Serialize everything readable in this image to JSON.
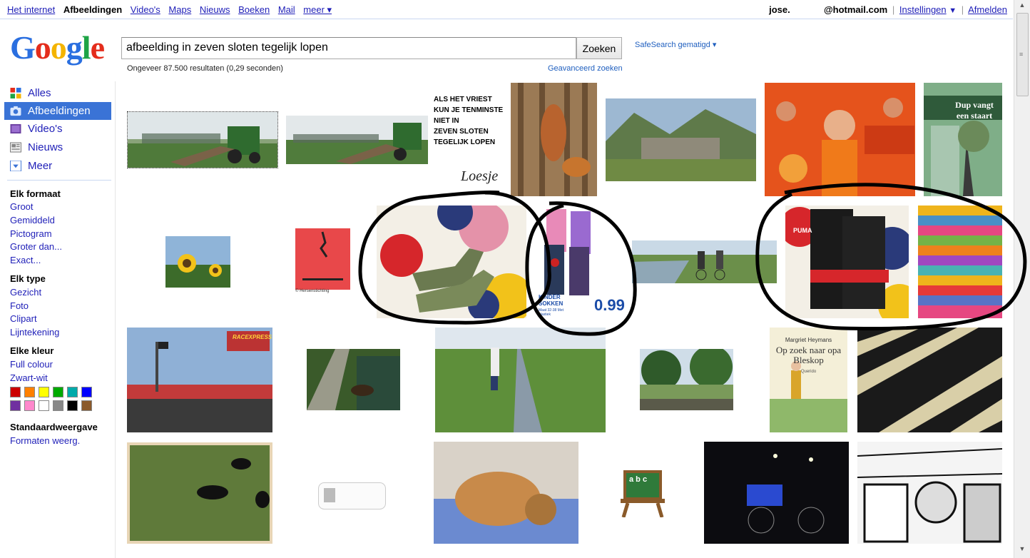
{
  "topnav": {
    "items": [
      "Het internet",
      "Afbeeldingen",
      "Video's",
      "Maps",
      "Nieuws",
      "Boeken",
      "Mail",
      "meer ▾"
    ],
    "active_index": 1
  },
  "account": {
    "user": "jose.",
    "email": "@hotmail.com",
    "settings": "Instellingen",
    "settings_arrow": "▼",
    "signout": "Afmelden"
  },
  "logo": {
    "letters": [
      "G",
      "o",
      "o",
      "g",
      "l",
      "e"
    ]
  },
  "search": {
    "query": "afbeelding in zeven sloten tegelijk lopen",
    "button": "Zoeken",
    "safesearch": "SafeSearch gematigd ▾",
    "stats": "Ongeveer 87.500 resultaten (0,29 seconden)",
    "advanced": "Geavanceerd zoeken"
  },
  "leftnav": {
    "items": [
      {
        "label": "Alles",
        "icon": "all-icon"
      },
      {
        "label": "Afbeeldingen",
        "icon": "camera-icon",
        "active": true
      },
      {
        "label": "Video's",
        "icon": "film-icon"
      },
      {
        "label": "Nieuws",
        "icon": "newspaper-icon"
      },
      {
        "label": "Meer",
        "icon": "chevron-down-icon"
      }
    ],
    "format_heading": "Elk formaat",
    "format_options": [
      "Groot",
      "Gemiddeld",
      "Pictogram",
      "Groter dan...",
      "Exact..."
    ],
    "type_heading": "Elk type",
    "type_options": [
      "Gezicht",
      "Foto",
      "Clipart",
      "Lijntekening"
    ],
    "color_heading": "Elke kleur",
    "color_options": [
      "Full colour",
      "Zwart-wit"
    ],
    "swatches": [
      "#cc0000",
      "#ff8000",
      "#ffff00",
      "#00aa00",
      "#00aaaa",
      "#0000ff",
      "#7030a0",
      "#ff88cc",
      "#ffffff",
      "#888888",
      "#000000",
      "#8b5a2b"
    ],
    "view_heading": "Standaardweergave",
    "view_option": "Formaten weerg."
  },
  "images": {
    "poster_lines": [
      "Als het vriest",
      "kun je tenminste",
      "niet in",
      "zeven sloten",
      "tegelijk lopen"
    ],
    "poster_signature": "Loesje",
    "book1_title": "Dup vangt een staart",
    "book2_author": "Margriet Heymans",
    "book2_title": "Op zoek naar opa Bleskop",
    "book2_publisher": "Querido",
    "sock_label": "KINDER SOKKEN",
    "sock_sub": "Maat 32-38 Met elastiek",
    "sock_price": "0.99",
    "puma_label": "PUMA",
    "race_label": "RACEXPRESS",
    "copyright_caption": "© Hersenstichting",
    "clipart_text": "a b c"
  },
  "colors": {
    "link": "#1f1fb8",
    "active_nav": "#3a73d6",
    "divider": "#c9d7f1"
  }
}
